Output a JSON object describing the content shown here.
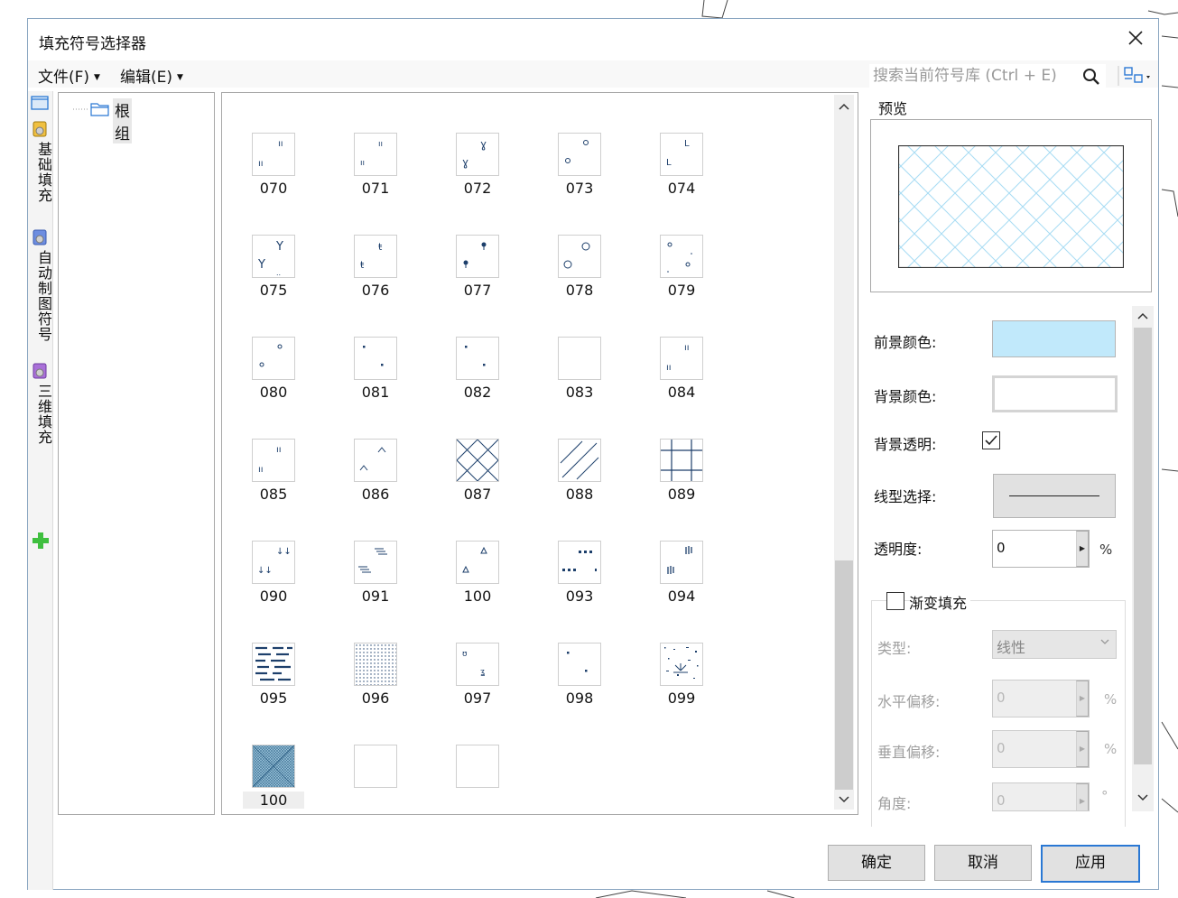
{
  "window": {
    "title": "填充符号选择器"
  },
  "menubar": {
    "file": "文件(F)",
    "edit": "编辑(E)"
  },
  "search": {
    "placeholder": "搜索当前符号库 (Ctrl + E)"
  },
  "side_tabs": [
    {
      "label": "基础填充",
      "icon": "fill-library-icon"
    },
    {
      "label": "自动制图符号",
      "icon": "fill-library-icon"
    },
    {
      "label": "三维填充",
      "icon": "fill-library-icon"
    }
  ],
  "tree": {
    "root": "根组"
  },
  "symbols": [
    {
      "num": "070",
      "icon": "ll-ticks"
    },
    {
      "num": "071",
      "icon": "ll-ticks-small"
    },
    {
      "num": "072",
      "icon": "grass-tuft"
    },
    {
      "num": "073",
      "icon": "ring-dot"
    },
    {
      "num": "074",
      "icon": "l-mark"
    },
    {
      "num": "075",
      "icon": "y-mark"
    },
    {
      "num": "076",
      "icon": "t-mark"
    },
    {
      "num": "077",
      "icon": "pin-mark"
    },
    {
      "num": "078",
      "icon": "circle-mark"
    },
    {
      "num": "079",
      "icon": "scattered-marks"
    },
    {
      "num": "080",
      "icon": "small-ring"
    },
    {
      "num": "081",
      "icon": "dots"
    },
    {
      "num": "082",
      "icon": "dots"
    },
    {
      "num": "083",
      "icon": "blank"
    },
    {
      "num": "084",
      "icon": "double-ticks"
    },
    {
      "num": "085",
      "icon": "double-ticks"
    },
    {
      "num": "086",
      "icon": "caret-mark"
    },
    {
      "num": "087",
      "icon": "cross-hatch"
    },
    {
      "num": "088",
      "icon": "diagonal-lines"
    },
    {
      "num": "089",
      "icon": "grid-lines"
    },
    {
      "num": "090",
      "icon": "arrow-ticks"
    },
    {
      "num": "091",
      "icon": "dash-lines"
    },
    {
      "num": "100",
      "icon": "triangle-mark"
    },
    {
      "num": "093",
      "icon": "dotted-rows"
    },
    {
      "num": "094",
      "icon": "bar-ticks"
    },
    {
      "num": "095",
      "icon": "dense-dashes"
    },
    {
      "num": "096",
      "icon": "fine-dots"
    },
    {
      "num": "097",
      "icon": "small-glyphs"
    },
    {
      "num": "098",
      "icon": "dots"
    },
    {
      "num": "099",
      "icon": "mixed-pattern"
    },
    {
      "num": "100",
      "icon": "dense-cross-hatch",
      "selected": true
    },
    {
      "num": "",
      "icon": "blank"
    },
    {
      "num": "",
      "icon": "blank"
    }
  ],
  "preview": {
    "legend": "预览",
    "pattern_color": "#a8dcf3"
  },
  "props": {
    "fg_label": "前景颜色:",
    "fg_color": "#c1e9fb",
    "bg_label": "背景颜色:",
    "bg_color": "#ffffff",
    "bg_transparent_label": "背景透明:",
    "bg_transparent": true,
    "line_label": "线型选择:",
    "opacity_label": "透明度:",
    "opacity_value": "0",
    "percent": "%",
    "gradient_label": "渐变填充",
    "gradient": false,
    "type_label": "类型:",
    "type_value": "线性",
    "hoffset_label": "水平偏移:",
    "hoffset_value": "0",
    "voffset_label": "垂直偏移:",
    "voffset_value": "0",
    "angle_label": "角度:",
    "angle_value": "0",
    "degree": "°"
  },
  "buttons": {
    "ok": "确定",
    "cancel": "取消",
    "apply": "应用"
  }
}
